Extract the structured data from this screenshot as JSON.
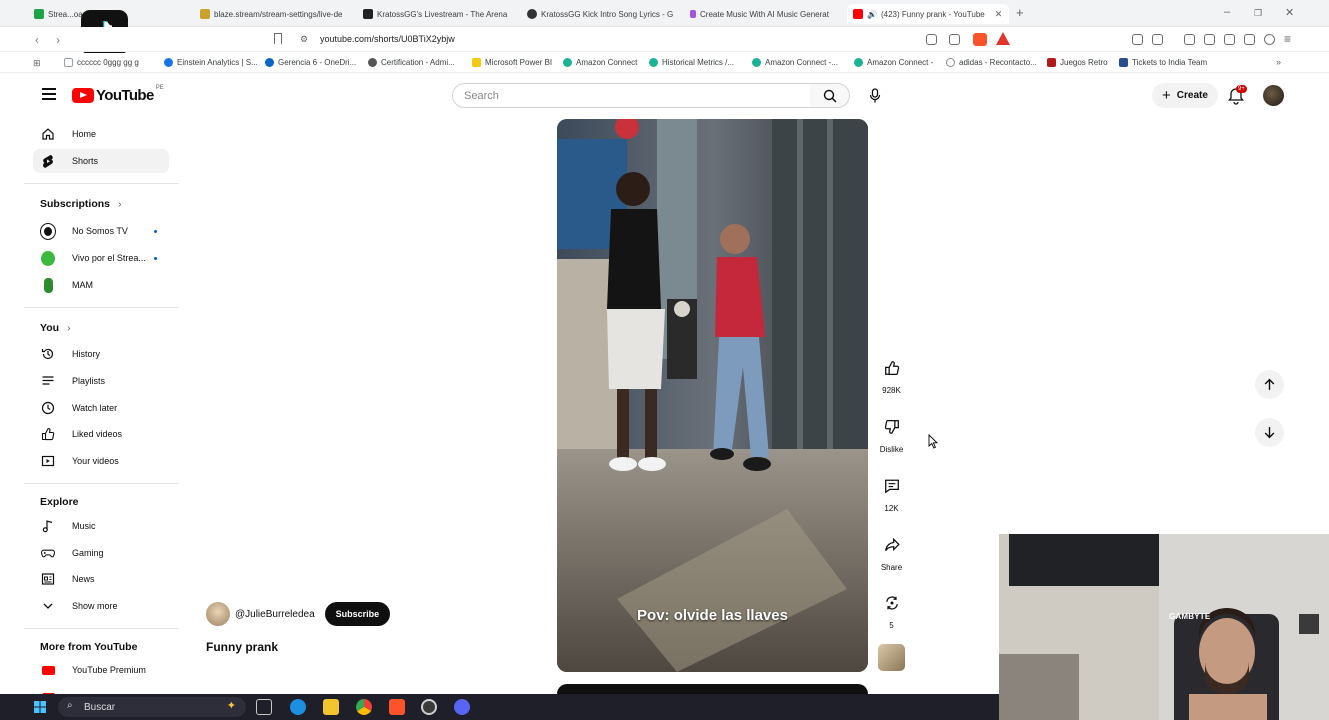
{
  "browser": {
    "tabs": [
      {
        "title": "Strea...oard",
        "color": "#1ea446"
      },
      {
        "title": "blaze.stream/stream-settings/live-de",
        "color": "#caa12b"
      },
      {
        "title": "KratossGG's Livestream - The Arena",
        "color": "#222222"
      },
      {
        "title": "KratossGG Kick Intro Song Lyrics - G",
        "color": "#333333"
      },
      {
        "title": "Create Music With AI Music Generat",
        "color": "#a256d8"
      },
      {
        "title": "(423) Funny prank - YouTube",
        "color": "#ff0000",
        "active": true
      }
    ],
    "url": "youtube.com/shorts/U0BTiX2ybjw",
    "bookmarks": [
      {
        "label": "cccccc 0ggg gg g",
        "color": "#9aa0a6"
      },
      {
        "label": "Einstein Analytics | S...",
        "color": "#1a73e8"
      },
      {
        "label": "Gerencia 6 - OneDri...",
        "color": "#0a64c8"
      },
      {
        "label": "Certification - Admi...",
        "color": "#555555"
      },
      {
        "label": "Microsoft Power BI",
        "color": "#f2c811"
      },
      {
        "label": "Amazon Connect",
        "color": "#1ab394"
      },
      {
        "label": "Historical Metrics /...",
        "color": "#1ab394"
      },
      {
        "label": "Amazon Connect -...",
        "color": "#1ab394"
      },
      {
        "label": "Amazon Connect -",
        "color": "#1ab394"
      },
      {
        "label": "adidas - Recontacto...",
        "color": "#888888"
      },
      {
        "label": "Juegos Retro",
        "color": "#b31b1b"
      },
      {
        "label": "Tickets to India Team",
        "color": "#264f8c"
      }
    ]
  },
  "youtube": {
    "logo_text": "YouTube",
    "country_code": "PE",
    "search_placeholder": "Search",
    "create_label": "Create",
    "notification_count": "9+",
    "sidebar": {
      "main": [
        {
          "label": "Home",
          "icon": "home-icon"
        },
        {
          "label": "Shorts",
          "icon": "shorts-icon",
          "active": true
        }
      ],
      "subscriptions_heading": "Subscriptions",
      "subscriptions": [
        {
          "label": "No Somos TV",
          "dot": true,
          "color": "#111111"
        },
        {
          "label": "Vivo por el Strea...",
          "dot": true,
          "color": "#3db83d"
        },
        {
          "label": "MAM",
          "dot": false,
          "color": "#2e8b2e"
        }
      ],
      "you_heading": "You",
      "you": [
        {
          "label": "History",
          "icon": "history-icon"
        },
        {
          "label": "Playlists",
          "icon": "playlists-icon"
        },
        {
          "label": "Watch later",
          "icon": "watch-later-icon"
        },
        {
          "label": "Liked videos",
          "icon": "like-icon"
        },
        {
          "label": "Your videos",
          "icon": "your-videos-icon"
        }
      ],
      "explore_heading": "Explore",
      "explore": [
        {
          "label": "Music",
          "icon": "music-icon"
        },
        {
          "label": "Gaming",
          "icon": "gaming-icon"
        },
        {
          "label": "News",
          "icon": "news-icon"
        },
        {
          "label": "Show more",
          "icon": "chevron-down-icon"
        }
      ],
      "more_heading": "More from YouTube",
      "more": [
        {
          "label": "YouTube Premium",
          "icon": "youtube-premium-icon"
        }
      ]
    },
    "short": {
      "caption": "Pov: olvide las llaves",
      "channel": "@JulieBurreledea",
      "subscribe_label": "Subscribe",
      "title": "Funny prank",
      "likes": "928K",
      "dislike_label": "Dislike",
      "comments": "12K",
      "share_label": "Share",
      "remix_count": "5"
    }
  },
  "webcam": {
    "overlay_text": "GAMBYTE"
  },
  "taskbar": {
    "search_label": "Buscar"
  }
}
